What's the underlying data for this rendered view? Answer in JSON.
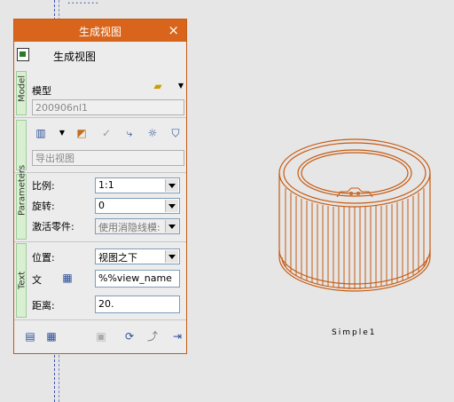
{
  "panel": {
    "title": "生成视图",
    "header_label": "生成视图",
    "close_icon": "close-icon",
    "model": {
      "tab": "Model",
      "label": "模型",
      "value": "200906nl1"
    },
    "views": {
      "tab": "",
      "export_placeholder": "导出视图"
    },
    "parameters": {
      "tab": "Parameters",
      "scale_label": "比例:",
      "scale_value": "1:1",
      "rotate_label": "旋转:",
      "rotate_value": "0",
      "activate_label": "激活零件:",
      "activate_value": "使用消隐线模:"
    },
    "text": {
      "tab": "Text",
      "position_label": "位置:",
      "position_value": "视图之下",
      "text_label": "文",
      "text_value": "%%view_name",
      "distance_label": "距离:",
      "distance_value": "20."
    }
  },
  "viewport": {
    "view_label": "Simple1",
    "top_text": "........"
  },
  "colors": {
    "accent": "#d9651c",
    "drawing": "#c55a11"
  }
}
